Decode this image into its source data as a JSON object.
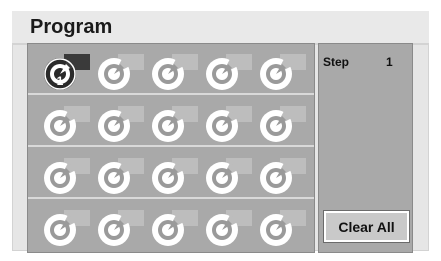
{
  "header": {
    "title": "Program"
  },
  "side": {
    "step_label": "Step",
    "step_value": "1",
    "clear_label": "Clear All"
  },
  "grid": {
    "rows": 4,
    "cols": 5,
    "selected_index": 0,
    "selected_number": "1",
    "slot_icon": "disc-slot-icon"
  },
  "colors": {
    "grid_bg": "#a9a9a9",
    "slot_tab": "#bdbdbd",
    "selected_tab": "#3a3a3a"
  }
}
